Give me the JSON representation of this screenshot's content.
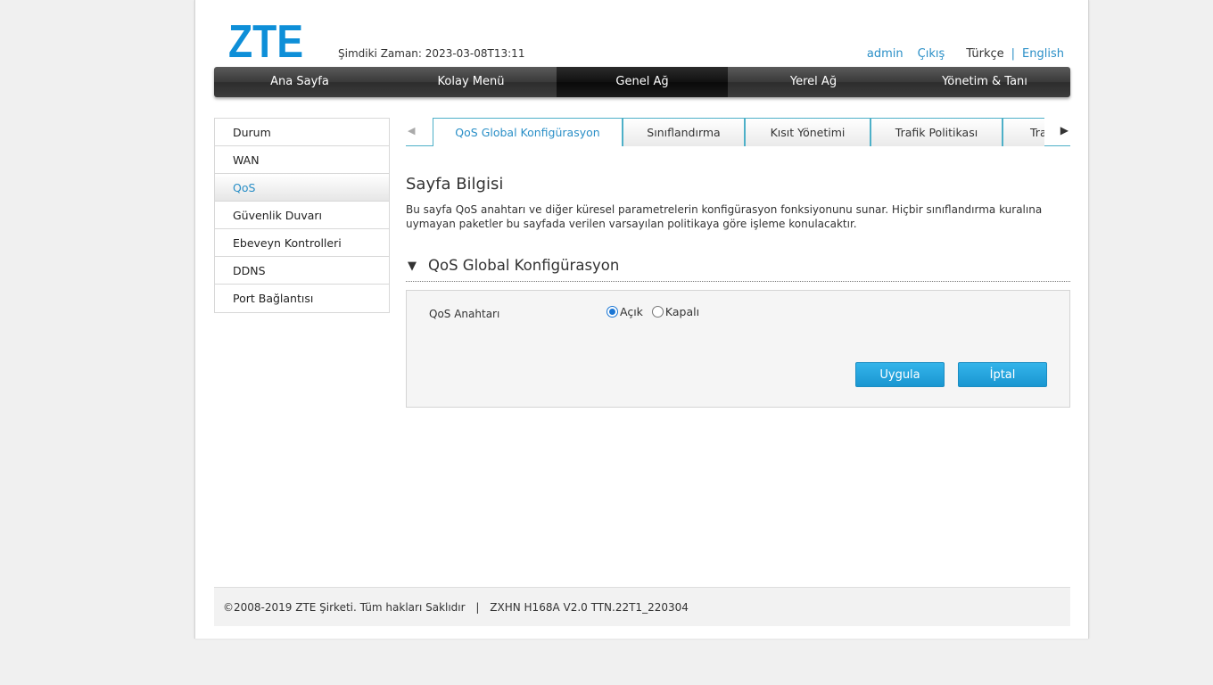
{
  "header": {
    "logo_text": "ZTE",
    "time_label": "Şimdiki Zaman:",
    "time_value": "2023-03-08T13:11",
    "user": "admin",
    "logout": "Çıkış",
    "lang_current": "Türkçe",
    "lang_separator": "|",
    "lang_alt": "English"
  },
  "main_nav": [
    {
      "label": "Ana Sayfa",
      "active": false
    },
    {
      "label": "Kolay Menü",
      "active": false
    },
    {
      "label": "Genel Ağ",
      "active": true
    },
    {
      "label": "Yerel Ağ",
      "active": false
    },
    {
      "label": "Yönetim & Tanı",
      "active": false
    }
  ],
  "sidebar": [
    {
      "label": "Durum",
      "active": false
    },
    {
      "label": "WAN",
      "active": false
    },
    {
      "label": "QoS",
      "active": true
    },
    {
      "label": "Güvenlik Duvarı",
      "active": false
    },
    {
      "label": "Ebeveyn Kontrolleri",
      "active": false
    },
    {
      "label": "DDNS",
      "active": false
    },
    {
      "label": "Port Bağlantısı",
      "active": false
    }
  ],
  "tabs": [
    {
      "label": "QoS Global Konfigürasyon",
      "active": true
    },
    {
      "label": "Sınıflandırma",
      "active": false
    },
    {
      "label": "Kısıt Yönetimi",
      "active": false
    },
    {
      "label": "Trafik Politikası",
      "active": false
    },
    {
      "label": "Tra",
      "active": false
    }
  ],
  "page_info": {
    "title": "Sayfa Bilgisi",
    "text": "Bu sayfa QoS anahtarı ve diğer küresel parametrelerin konfigürasyon fonksiyonunu sunar. Hiçbir sınıflandırma kuralına uymayan paketler bu sayfada verilen varsayılan politikaya göre işleme konulacaktır."
  },
  "section": {
    "arrow": "▼",
    "title": "QoS Global Konfigürasyon"
  },
  "form": {
    "qos_label": "QoS Anahtarı",
    "option_on": "Açık",
    "option_off": "Kapalı",
    "selected": "on",
    "apply": "Uygula",
    "cancel": "İptal"
  },
  "footer": {
    "copyright": "©2008-2019 ZTE Şirketi. Tüm hakları Saklıdır",
    "separator": "|",
    "version": "ZXHN H168A V2.0 TTN.22T1_220304"
  },
  "colors": {
    "accent": "#2a8fc7",
    "button": "#1a96d1",
    "logo": "#0e8fd8"
  }
}
